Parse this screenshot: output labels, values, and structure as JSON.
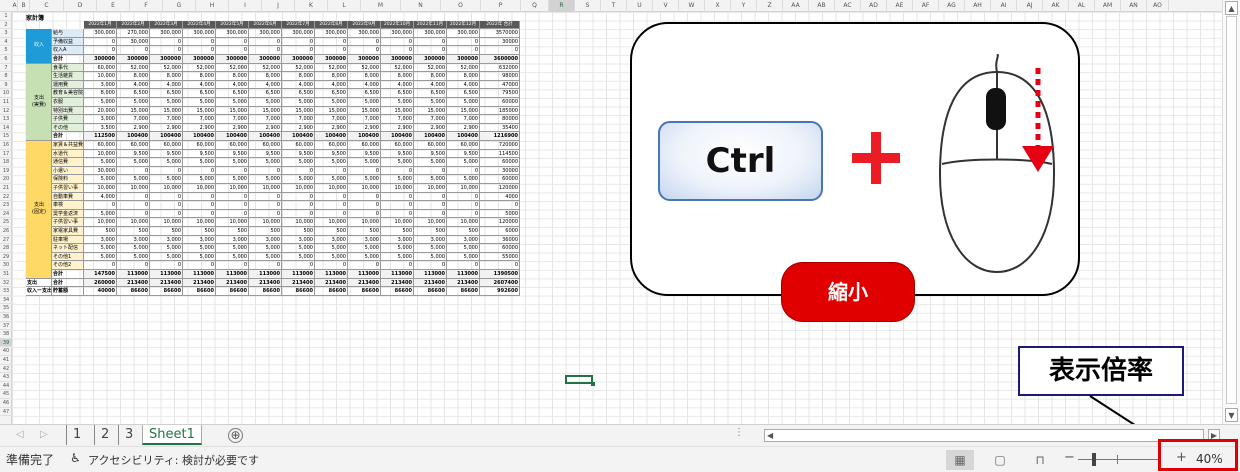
{
  "sheet": {
    "title": "家計簿",
    "months": [
      "2022年1月",
      "2022年2月",
      "2022年3月",
      "2022年4月",
      "2022年5月",
      "2022年6月",
      "2022年7月",
      "2022年8月",
      "2022年9月",
      "2022年10月",
      "2022年11月",
      "2022年12月",
      "2022年 合計"
    ],
    "sections": {
      "income": "収入",
      "fixed": "支出\n(実費)",
      "variable": "支出\n(固定)"
    },
    "rows": [
      {
        "r": "3",
        "cat": "給与",
        "vals": [
          "300,000",
          "270,000",
          "300,000",
          "300,000",
          "300,000",
          "300,000",
          "300,000",
          "300,000",
          "300,000",
          "300,000",
          "300,000",
          "300,000",
          "3570000"
        ]
      },
      {
        "r": "4",
        "cat": "予備収益",
        "vals": [
          "0",
          "30,000",
          "0",
          "0",
          "0",
          "0",
          "0",
          "0",
          "0",
          "0",
          "0",
          "0",
          "30000"
        ]
      },
      {
        "r": "5",
        "cat": "収入A",
        "vals": [
          "0",
          "0",
          "0",
          "0",
          "0",
          "0",
          "0",
          "0",
          "0",
          "0",
          "0",
          "0",
          "0"
        ]
      },
      {
        "r": "6",
        "cat": "合計",
        "vals": [
          "300000",
          "300000",
          "300000",
          "300000",
          "300000",
          "300000",
          "300000",
          "300000",
          "300000",
          "300000",
          "300000",
          "300000",
          "3600000"
        ]
      },
      {
        "r": "7",
        "cat": "食事代",
        "vals": [
          "60,000",
          "52,000",
          "52,000",
          "52,000",
          "52,000",
          "52,000",
          "52,000",
          "52,000",
          "52,000",
          "52,000",
          "52,000",
          "52,000",
          "632000"
        ]
      },
      {
        "r": "8",
        "cat": "生活雑貨",
        "vals": [
          "10,000",
          "8,000",
          "8,000",
          "8,000",
          "8,000",
          "8,000",
          "8,000",
          "8,000",
          "8,000",
          "8,000",
          "8,000",
          "8,000",
          "98000"
        ]
      },
      {
        "r": "9",
        "cat": "運用費",
        "vals": [
          "3,000",
          "4,000",
          "4,000",
          "4,000",
          "4,000",
          "4,000",
          "4,000",
          "4,000",
          "4,000",
          "4,000",
          "4,000",
          "4,000",
          "47000"
        ]
      },
      {
        "r": "10",
        "cat": "教育＆美容院",
        "vals": [
          "8,000",
          "6,500",
          "6,500",
          "6,500",
          "6,500",
          "6,500",
          "6,500",
          "6,500",
          "6,500",
          "6,500",
          "6,500",
          "6,500",
          "79500"
        ]
      },
      {
        "r": "11",
        "cat": "衣服",
        "vals": [
          "5,000",
          "5,000",
          "5,000",
          "5,000",
          "5,000",
          "5,000",
          "5,000",
          "5,000",
          "5,000",
          "5,000",
          "5,000",
          "5,000",
          "60000"
        ]
      },
      {
        "r": "12",
        "cat": "特別出費",
        "vals": [
          "20,000",
          "15,000",
          "15,000",
          "15,000",
          "15,000",
          "15,000",
          "15,000",
          "15,000",
          "15,000",
          "15,000",
          "15,000",
          "15,000",
          "185000"
        ]
      },
      {
        "r": "13",
        "cat": "子供費",
        "vals": [
          "3,000",
          "7,000",
          "7,000",
          "7,000",
          "7,000",
          "7,000",
          "7,000",
          "7,000",
          "7,000",
          "7,000",
          "7,000",
          "7,000",
          "80000"
        ]
      },
      {
        "r": "14",
        "cat": "その他",
        "vals": [
          "3,500",
          "2,900",
          "2,900",
          "2,900",
          "2,900",
          "2,900",
          "2,900",
          "2,900",
          "2,900",
          "2,900",
          "2,900",
          "2,900",
          "35400"
        ]
      },
      {
        "r": "15",
        "cat": "合計",
        "vals": [
          "112500",
          "100400",
          "100400",
          "100400",
          "100400",
          "100400",
          "100400",
          "100400",
          "100400",
          "100400",
          "100400",
          "100400",
          "1216900"
        ]
      },
      {
        "r": "16",
        "cat": "家賃＆共益費",
        "vals": [
          "60,000",
          "60,000",
          "60,000",
          "60,000",
          "60,000",
          "60,000",
          "60,000",
          "60,000",
          "60,000",
          "60,000",
          "60,000",
          "60,000",
          "720000"
        ]
      },
      {
        "r": "17",
        "cat": "水道代",
        "vals": [
          "10,000",
          "9,500",
          "9,500",
          "9,500",
          "9,500",
          "9,500",
          "9,500",
          "9,500",
          "9,500",
          "9,500",
          "9,500",
          "9,500",
          "114500"
        ]
      },
      {
        "r": "18",
        "cat": "通信費",
        "vals": [
          "5,000",
          "5,000",
          "5,000",
          "5,000",
          "5,000",
          "5,000",
          "5,000",
          "5,000",
          "5,000",
          "5,000",
          "5,000",
          "5,000",
          "60000"
        ]
      },
      {
        "r": "19",
        "cat": "小遣い",
        "vals": [
          "30,000",
          "0",
          "0",
          "0",
          "0",
          "0",
          "0",
          "0",
          "0",
          "0",
          "0",
          "0",
          "30000"
        ]
      },
      {
        "r": "20",
        "cat": "保険料",
        "vals": [
          "5,000",
          "5,000",
          "5,000",
          "5,000",
          "5,000",
          "5,000",
          "5,000",
          "5,000",
          "5,000",
          "5,000",
          "5,000",
          "5,000",
          "60000"
        ]
      },
      {
        "r": "21",
        "cat": "子供習い事",
        "vals": [
          "10,000",
          "10,000",
          "10,000",
          "10,000",
          "10,000",
          "10,000",
          "10,000",
          "10,000",
          "10,000",
          "10,000",
          "10,000",
          "10,000",
          "120000"
        ]
      },
      {
        "r": "22",
        "cat": "自動車費",
        "vals": [
          "4,000",
          "0",
          "0",
          "0",
          "0",
          "0",
          "0",
          "0",
          "0",
          "0",
          "0",
          "0",
          "4000"
        ]
      },
      {
        "r": "23",
        "cat": "車検",
        "vals": [
          "0",
          "0",
          "0",
          "0",
          "0",
          "0",
          "0",
          "0",
          "0",
          "0",
          "0",
          "0",
          "0"
        ]
      },
      {
        "r": "24",
        "cat": "奨学金返済",
        "vals": [
          "5,000",
          "0",
          "0",
          "0",
          "0",
          "0",
          "0",
          "0",
          "0",
          "0",
          "0",
          "0",
          "5000"
        ]
      },
      {
        "r": "25",
        "cat": "子供習い事",
        "vals": [
          "10,000",
          "10,000",
          "10,000",
          "10,000",
          "10,000",
          "10,000",
          "10,000",
          "10,000",
          "10,000",
          "10,000",
          "10,000",
          "10,000",
          "120000"
        ]
      },
      {
        "r": "26",
        "cat": "家電家具費",
        "vals": [
          "500",
          "500",
          "500",
          "500",
          "500",
          "500",
          "500",
          "500",
          "500",
          "500",
          "500",
          "500",
          "6000"
        ]
      },
      {
        "r": "27",
        "cat": "駐車場",
        "vals": [
          "3,000",
          "3,000",
          "3,000",
          "3,000",
          "3,000",
          "3,000",
          "3,000",
          "3,000",
          "3,000",
          "3,000",
          "3,000",
          "3,000",
          "36000"
        ]
      },
      {
        "r": "28",
        "cat": "ネット配信",
        "vals": [
          "5,000",
          "5,000",
          "5,000",
          "5,000",
          "5,000",
          "5,000",
          "5,000",
          "5,000",
          "5,000",
          "5,000",
          "5,000",
          "5,000",
          "60000"
        ]
      },
      {
        "r": "29",
        "cat": "その他1",
        "vals": [
          "5,000",
          "5,000",
          "5,000",
          "5,000",
          "5,000",
          "5,000",
          "5,000",
          "5,000",
          "5,000",
          "5,000",
          "5,000",
          "5,000",
          "55000"
        ]
      },
      {
        "r": "30",
        "cat": "その他2",
        "vals": [
          "0",
          "0",
          "0",
          "0",
          "0",
          "0",
          "0",
          "0",
          "0",
          "0",
          "0",
          "0",
          "0"
        ]
      },
      {
        "r": "31",
        "cat": "合計",
        "vals": [
          "147500",
          "113000",
          "113000",
          "113000",
          "113000",
          "113000",
          "113000",
          "113000",
          "113000",
          "113000",
          "113000",
          "113000",
          "1390500"
        ]
      },
      {
        "r": "32",
        "sec": "支出",
        "cat": "合計",
        "vals": [
          "260000",
          "213400",
          "213400",
          "213400",
          "213400",
          "213400",
          "213400",
          "213400",
          "213400",
          "213400",
          "213400",
          "213400",
          "2607400"
        ]
      },
      {
        "r": "33",
        "sec": "収入ー支出",
        "cat": "貯蓄額",
        "vals": [
          "40000",
          "86600",
          "86600",
          "86600",
          "86600",
          "86600",
          "86600",
          "86600",
          "86600",
          "86600",
          "86600",
          "86600",
          "992600"
        ]
      }
    ]
  },
  "columns": [
    "A",
    "B",
    "C",
    "D",
    "E",
    "F",
    "G",
    "H",
    "I",
    "J",
    "K",
    "L",
    "M",
    "N",
    "O",
    "P",
    "Q",
    "R",
    "S",
    "T",
    "U",
    "V",
    "W",
    "X",
    "Y",
    "Z",
    "AA",
    "AB",
    "AC",
    "AD",
    "AE",
    "AF",
    "AG",
    "AH",
    "AI",
    "AJ",
    "AK",
    "AL",
    "AM",
    "AN",
    "AO"
  ],
  "selected_column": "R",
  "selected_row": "39",
  "overlay": {
    "ctrl_label": "Ctrl",
    "shrink_label": "縮小",
    "zoom_callout": "表示倍率",
    "accent": "#e00000"
  },
  "tabs": [
    "1",
    "2",
    "3",
    "Sheet1"
  ],
  "active_tab": "Sheet1",
  "add_sheet": "⊕",
  "status": {
    "ready": "準備完了",
    "accessibility": "アクセシビリティ: 検討が必要です",
    "zoom_minus": "−",
    "zoom_plus": "+",
    "zoom": "40%"
  }
}
